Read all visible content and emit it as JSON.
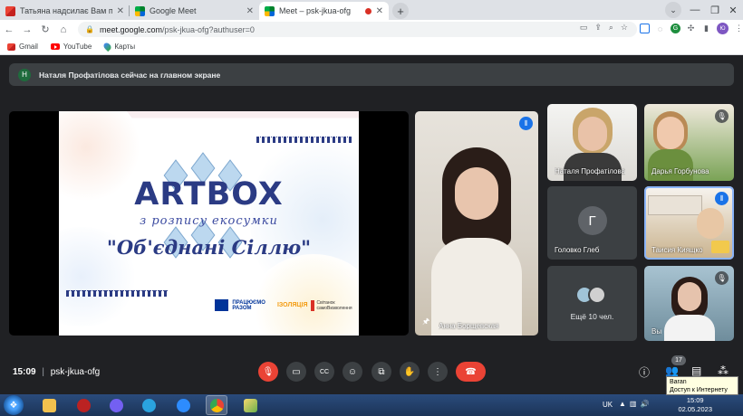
{
  "browser": {
    "tabs": [
      {
        "label": "Татьяна надсилає Вам повідомл",
        "favicon": "gmail-icon",
        "active": false
      },
      {
        "label": "Google Meet",
        "favicon": "meet-icon",
        "active": false
      },
      {
        "label": "Meet – psk-jkua-ofg",
        "favicon": "meet-icon",
        "active": true
      }
    ],
    "new_tab": "+",
    "url_domain": "meet.google.com",
    "url_path": "/psk-jkua-ofg?authuser=0",
    "profile_initial": "Ю",
    "bookmarks": [
      "Gmail",
      "YouTube",
      "Карты"
    ]
  },
  "meet": {
    "banner_avatar": "Н",
    "banner_text": "Наталя Профатілова сейчас на главном экране",
    "slide": {
      "title": "ARTBOX",
      "subtitle": "з розписy екосyмки",
      "quote": "\"Об'єднані Сіллю\"",
      "logo_1": "ПРАЦЮЄМО РАЗОМ",
      "logo_2": "ІЗОЛЯЦІЯ",
      "logo_3": "Світанок самоВизволення"
    },
    "participants": [
      {
        "name": "Анна Борщевская",
        "mic": "active"
      },
      {
        "name": "Наталя Профатілова",
        "mic": "none"
      },
      {
        "name": "Дарья Горбунова",
        "mic": "muted"
      },
      {
        "name": "Головко Глеб",
        "initial": "Г",
        "mic": "none"
      },
      {
        "name": "Таисия Киящко",
        "mic": "active"
      },
      {
        "name": "Вы",
        "mic": "muted"
      }
    ],
    "more_label": "Ещё 10 чел.",
    "time": "15:09",
    "separator": "|",
    "meeting_code": "psk-jkua-ofg",
    "participant_count": "17",
    "colors": {
      "accent": "#1a73e8",
      "hangup": "#ea4335",
      "bg": "#202124"
    }
  },
  "taskbar": {
    "lang": "UK",
    "clock_time": "15:09",
    "clock_date": "02.05.2023",
    "tooltip_title": "Baran",
    "tooltip_text": "Доступ к Интернету"
  }
}
